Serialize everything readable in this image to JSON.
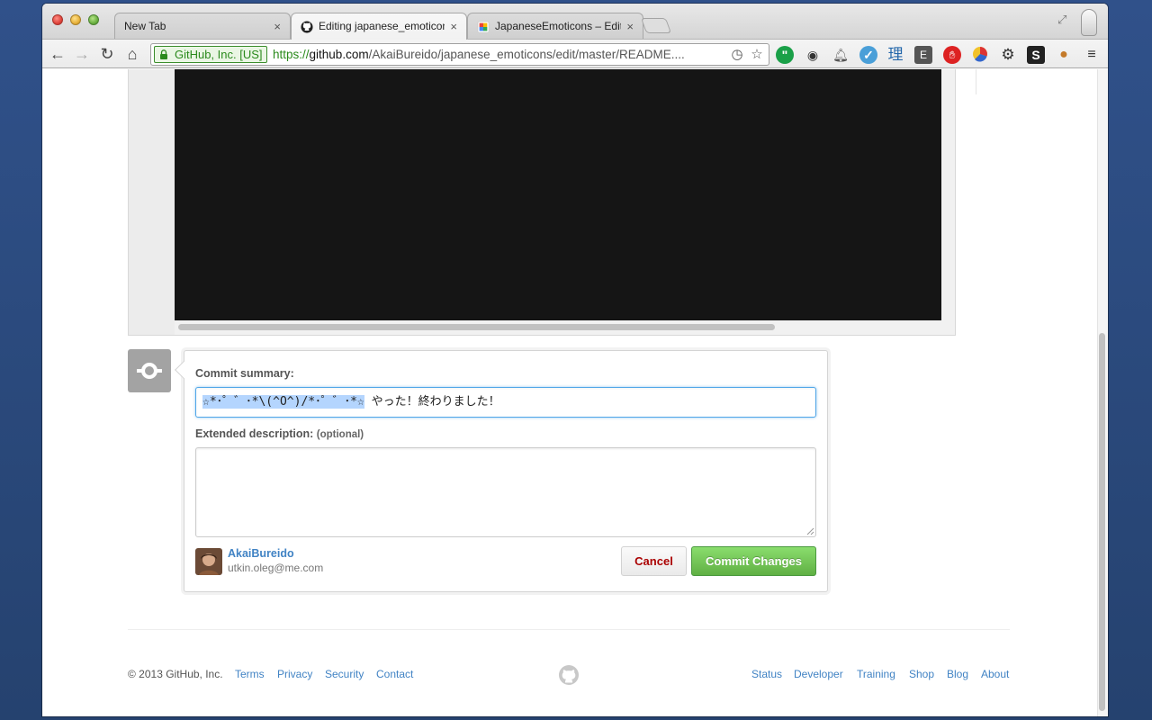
{
  "tabs": [
    {
      "label": "New Tab",
      "close": "×"
    },
    {
      "label": "Editing japanese_emoticon",
      "close": "×"
    },
    {
      "label": "JapaneseEmoticons – Edit I",
      "close": "×"
    }
  ],
  "omnibox": {
    "ev_label": "GitHub, Inc. [US]",
    "scheme": "https://",
    "host": "github.com",
    "path": "/AkaiBureido/japanese_emoticons/edit/master/README...."
  },
  "toolbar_icons": [
    "back-icon",
    "forward-icon",
    "reload-icon",
    "home-icon",
    "history-icon",
    "star-icon"
  ],
  "extensions": [
    "hangouts-icon",
    "extension-glasses-icon",
    "bell-icon",
    "extension-v-icon",
    "ri-kanji-icon",
    "evernote-icon",
    "adblock-icon",
    "piechart-icon",
    "gear-icon",
    "scribefire-icon",
    "cookie-icon",
    "menu-icon"
  ],
  "ext_glyphs": {
    "ri": "理"
  },
  "commit": {
    "summary_label": "Commit summary:",
    "summary_selected": "☆*･゜゛･*\\(^O^)/*･゜゛･*☆",
    "summary_rest": " やった！終わりました！",
    "description_label": "Extended description:",
    "description_optional": "(optional)",
    "description_value": "",
    "author_name": "AkaiBureido",
    "author_email": "utkin.oleg@me.com",
    "cancel_label": "Cancel",
    "commit_label": "Commit Changes"
  },
  "footer": {
    "copyright": "© 2013 GitHub, Inc.",
    "left_links": [
      "Terms",
      "Privacy",
      "Security",
      "Contact"
    ],
    "right_links": [
      "Status",
      "Developer",
      "Training",
      "Shop",
      "Blog",
      "About"
    ]
  },
  "colors": {
    "link": "#4183c4",
    "commit_green": "#60b044",
    "cancel_red": "#aa0000",
    "focus_blue": "#51a7e8",
    "editor_bg": "#151515"
  }
}
